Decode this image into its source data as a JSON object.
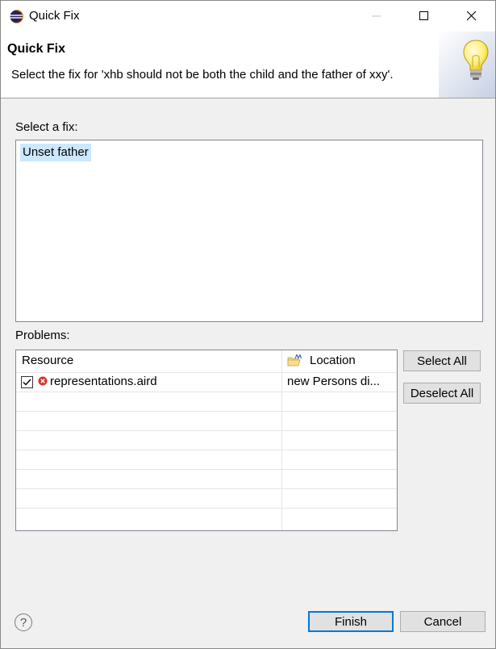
{
  "window": {
    "title": "Quick Fix"
  },
  "header": {
    "title": "Quick Fix",
    "description": "Select the fix for 'xhb should not be both the child and the father of xxy'."
  },
  "fixes": {
    "label": "Select a fix:",
    "items": [
      "Unset father"
    ]
  },
  "problems": {
    "label": "Problems:",
    "columns": {
      "resource": "Resource",
      "location": "Location"
    },
    "rows": [
      {
        "checked": true,
        "resource": "representations.aird",
        "location": "new Persons di..."
      }
    ]
  },
  "buttons": {
    "select_all": "Select All",
    "deselect_all": "Deselect All",
    "finish": "Finish",
    "cancel": "Cancel",
    "help": "?"
  },
  "colors": {
    "accent": "#0078d7",
    "selection": "#cce8ff",
    "error": "#d9342b"
  },
  "icons": [
    "eclipse-app-icon",
    "minimize-icon",
    "maximize-icon",
    "close-icon",
    "lightbulb-icon",
    "location-icon",
    "error-icon",
    "checkmark-icon",
    "help-icon"
  ]
}
